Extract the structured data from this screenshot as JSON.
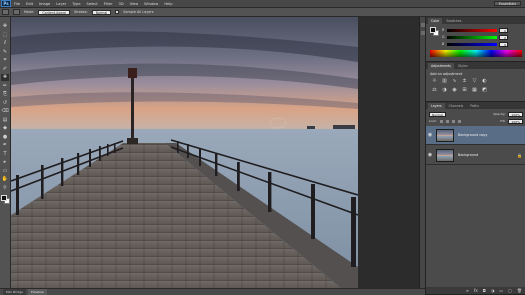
{
  "app": {
    "logo": "Ps"
  },
  "menubar": {
    "items": [
      "File",
      "Edit",
      "Image",
      "Layer",
      "Type",
      "Select",
      "Filter",
      "3D",
      "View",
      "Window",
      "Help"
    ],
    "workspace": "Essentials"
  },
  "options": {
    "mode_label": "Mode:",
    "mode_value": "Content-Aware",
    "strokes_label": "Strokes:",
    "strokes_value": "Normal",
    "sample_label": "Sample All Layers"
  },
  "tools": [
    "move-icon",
    "marquee-icon",
    "lasso-icon",
    "quick-select-icon",
    "crop-icon",
    "eyedropper-icon",
    "healing-icon",
    "brush-icon",
    "clone-stamp-icon",
    "history-brush-icon",
    "eraser-icon",
    "gradient-icon",
    "blur-icon",
    "dodge-icon",
    "pen-icon",
    "type-icon",
    "path-select-icon",
    "shape-icon",
    "hand-icon",
    "zoom-icon"
  ],
  "tool_glyphs": [
    "✥",
    "⬚",
    "ℓ",
    "✎",
    "⌗",
    "✐",
    "✚",
    "✏",
    "⎘",
    "↺",
    "⌫",
    "▤",
    "◆",
    "●",
    "✒",
    "T",
    "▸",
    "▭",
    "✋",
    "⚲"
  ],
  "colors": {
    "accent": "#5a6d86",
    "foreground": "#111111",
    "background": "#ffffff"
  },
  "color_panel": {
    "tabs": [
      "Color",
      "Swatches"
    ],
    "sliders": [
      {
        "label": "R",
        "value": "0"
      },
      {
        "label": "G",
        "value": "0"
      },
      {
        "label": "B",
        "value": "0"
      }
    ]
  },
  "adjustments_panel": {
    "tabs": [
      "Adjustments",
      "Styles"
    ],
    "title": "Add an adjustment",
    "icons": [
      "brightness-icon",
      "levels-icon",
      "curves-icon",
      "exposure-icon",
      "vibrance-icon",
      "hue-saturation-icon",
      "color-balance-icon",
      "black-white-icon",
      "photo-filter-icon",
      "channel-mixer-icon",
      "color-lookup-icon",
      "invert-icon"
    ],
    "glyphs": [
      "☼",
      "▥",
      "∿",
      "±",
      "▽",
      "◐",
      "⚖",
      "◑",
      "◉",
      "⊞",
      "▦",
      "◩"
    ]
  },
  "layers_panel": {
    "tabs": [
      "Layers",
      "Channels",
      "Paths"
    ],
    "blend_mode": "Normal",
    "opacity_label": "Opacity:",
    "opacity_value": "100%",
    "lock_label": "Lock:",
    "fill_label": "Fill:",
    "fill_value": "100%",
    "layers": [
      {
        "name": "Background copy",
        "selected": true
      },
      {
        "name": "Background",
        "selected": false
      }
    ],
    "footer_icons": [
      "link-icon",
      "fx-icon",
      "mask-icon",
      "adjustment-layer-icon",
      "group-icon",
      "new-layer-icon",
      "trash-icon"
    ],
    "footer_glyphs": [
      "∞",
      "fx",
      "◘",
      "◑",
      "▭",
      "▢",
      "🗑"
    ]
  },
  "statusbar": {
    "tabs": [
      "Mini Bridge",
      "Timeline"
    ]
  }
}
